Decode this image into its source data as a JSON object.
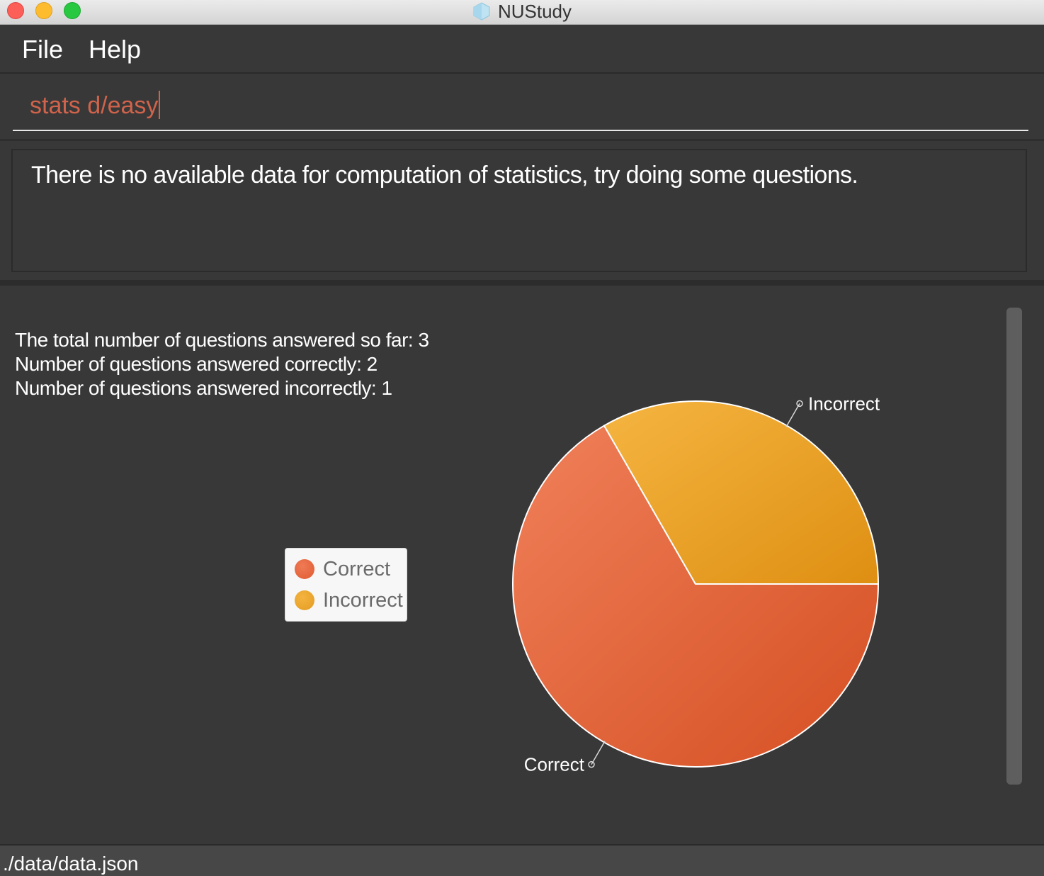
{
  "window": {
    "title": "NUStudy"
  },
  "menu": {
    "items": [
      {
        "label": "File"
      },
      {
        "label": "Help"
      }
    ]
  },
  "command": {
    "value": "stats d/easy"
  },
  "result": {
    "message": "There is no available data for computation of statistics, try doing some questions."
  },
  "stats": {
    "lines": [
      "The total number of questions answered so far: 3",
      "Number of questions answered correctly: 2",
      "Number of questions answered incorrectly: 1"
    ]
  },
  "colors": {
    "correct": "#e4683f",
    "incorrect": "#eda52f",
    "command_text": "#d0634b"
  },
  "chart_data": {
    "type": "pie",
    "categories": [
      "Correct",
      "Incorrect"
    ],
    "values": [
      2,
      1
    ],
    "legend": [
      "Correct",
      "Incorrect"
    ],
    "legend_position": "left"
  },
  "status": {
    "path": "./data/data.json"
  }
}
